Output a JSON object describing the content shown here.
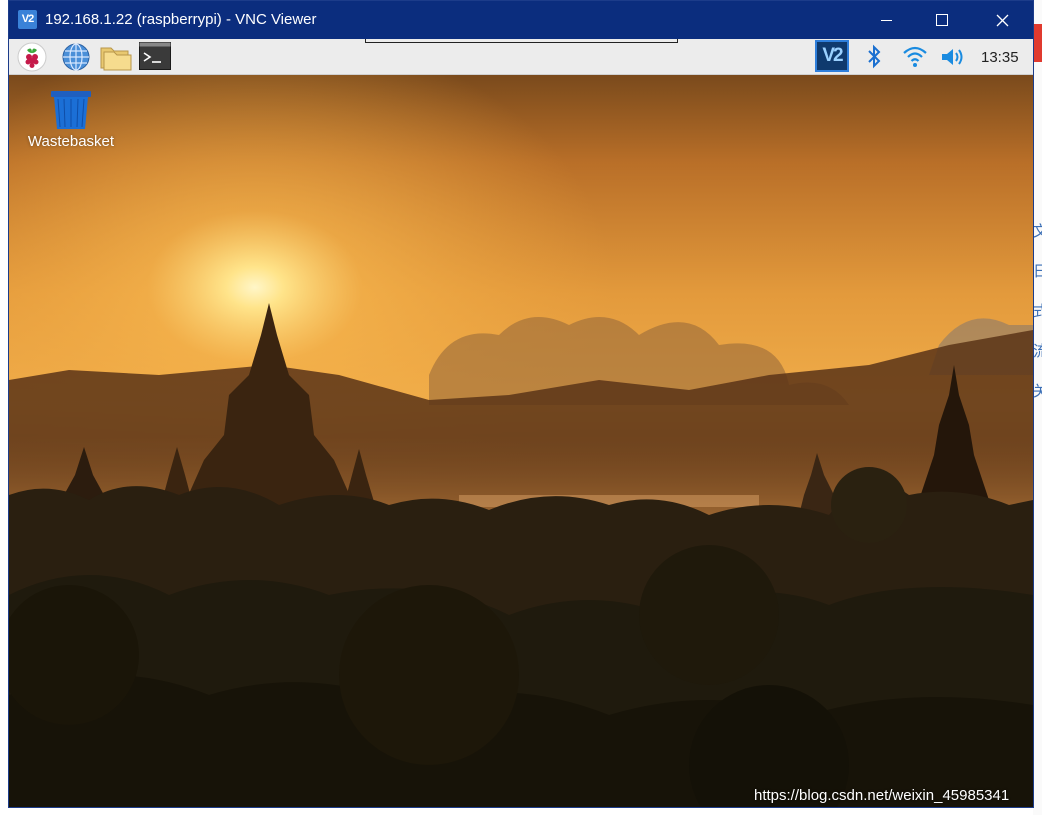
{
  "window": {
    "title": "192.168.1.22 (raspberrypi) - VNC Viewer",
    "app_icon_text": "V2"
  },
  "panel": {
    "launchers": [
      "raspberry-pi-menu-icon",
      "web-browser-icon",
      "file-manager-icon",
      "terminal-icon"
    ],
    "tray": [
      "vnc-server-icon",
      "bluetooth-icon",
      "wifi-icon",
      "volume-icon"
    ],
    "clock": "13:35"
  },
  "desktop": {
    "icons": [
      {
        "label": "Wastebasket",
        "icon": "trash-icon"
      }
    ]
  },
  "watermark": "https://blog.csdn.net/weixin_45985341",
  "colors": {
    "titlebar": "#0b2d7e",
    "panel": "#ececec",
    "sky": "#f0a640",
    "sun": "#fff3b0"
  }
}
